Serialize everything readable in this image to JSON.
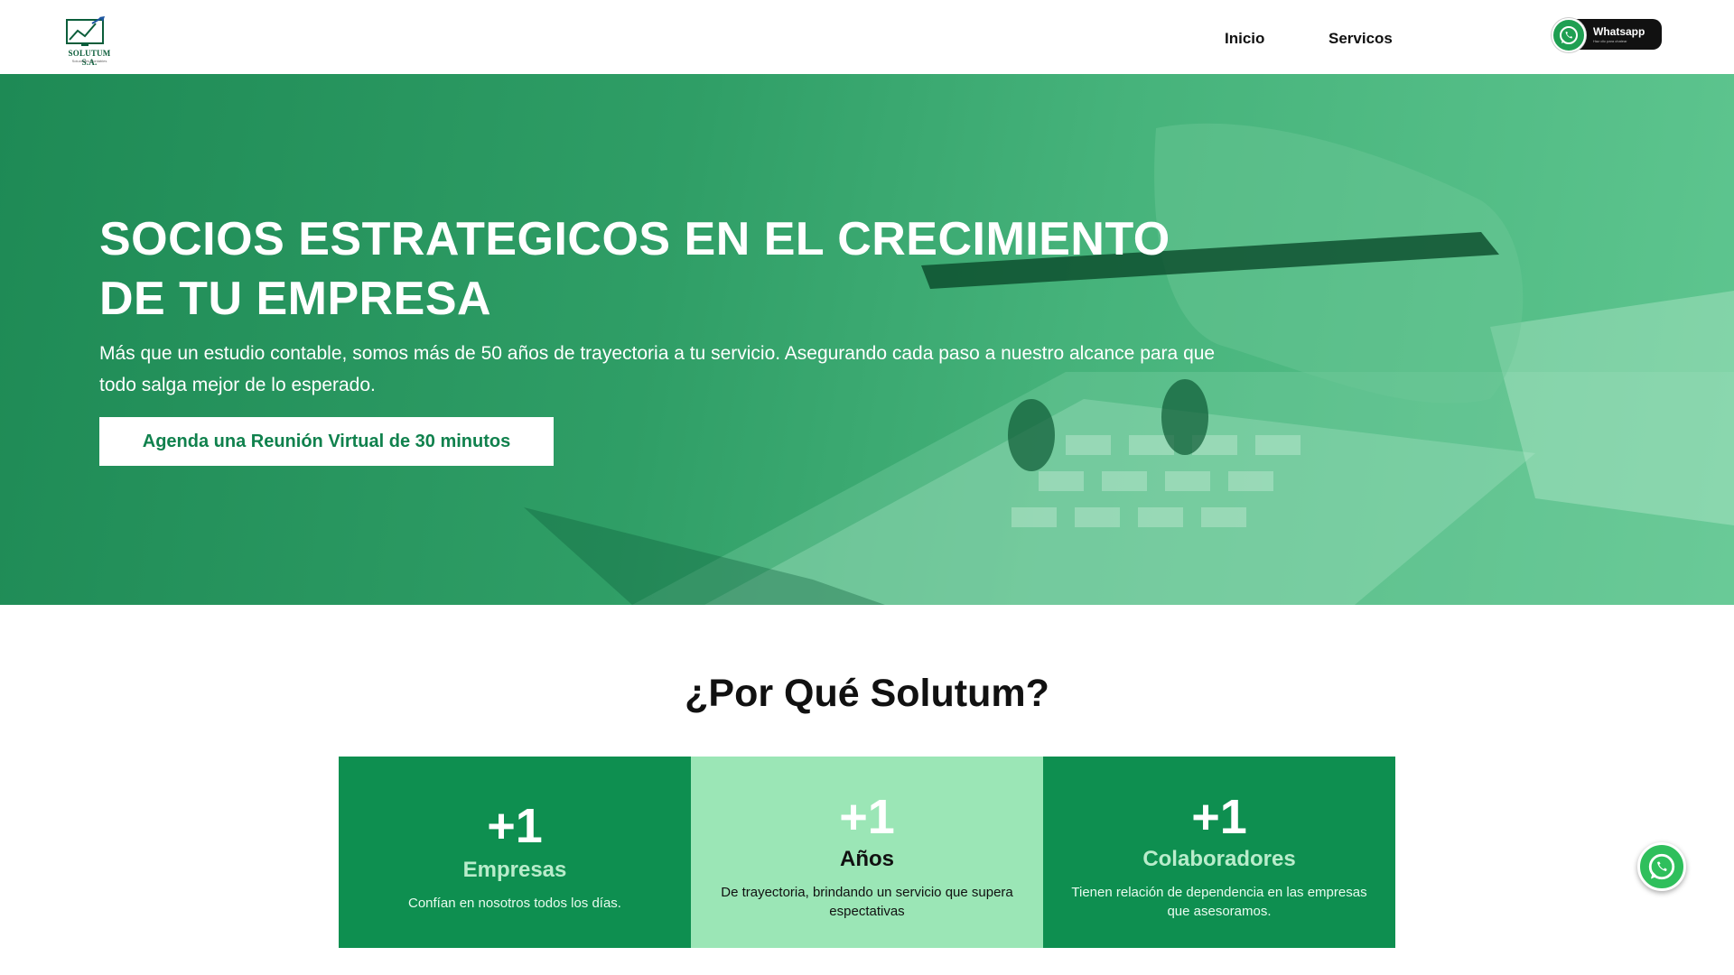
{
  "logo": {
    "name": "SOLUTUM S.A.",
    "tagline": "Soluciones Contables"
  },
  "nav": {
    "items": [
      "Inicio",
      "Servicos"
    ]
  },
  "whatsapp_button": {
    "label": "Whatsapp",
    "sub": "Haz clic para chatear"
  },
  "hero": {
    "title": "SOCIOS ESTRATEGICOS EN EL CRECIMIENTO DE TU EMPRESA",
    "description": "Más que un estudio contable, somos más de 50 años de trayectoria a tu servicio. Asegurando cada paso a nuestro alcance para que todo salga mejor de lo esperado.",
    "cta": "Agenda una Reunión Virtual de 30 minutos"
  },
  "why": {
    "title": "¿Por Qué Solutum?",
    "cards": [
      {
        "number": "+1",
        "label": "Empresas",
        "description": "Confían en nosotros todos los días."
      },
      {
        "number": "+1",
        "label": "Años",
        "description": "De trayectoria, brindando un servicio que supera espectativas"
      },
      {
        "number": "+1",
        "label": "Colaboradores",
        "description": "Tienen relación de dependencia en las empresas que asesoramos."
      }
    ]
  },
  "colors": {
    "brand_green": "#0e8f50",
    "light_green": "#9be6b6",
    "whatsapp": "#2fbf5c"
  },
  "icons": {
    "floating": "whatsapp-icon"
  }
}
